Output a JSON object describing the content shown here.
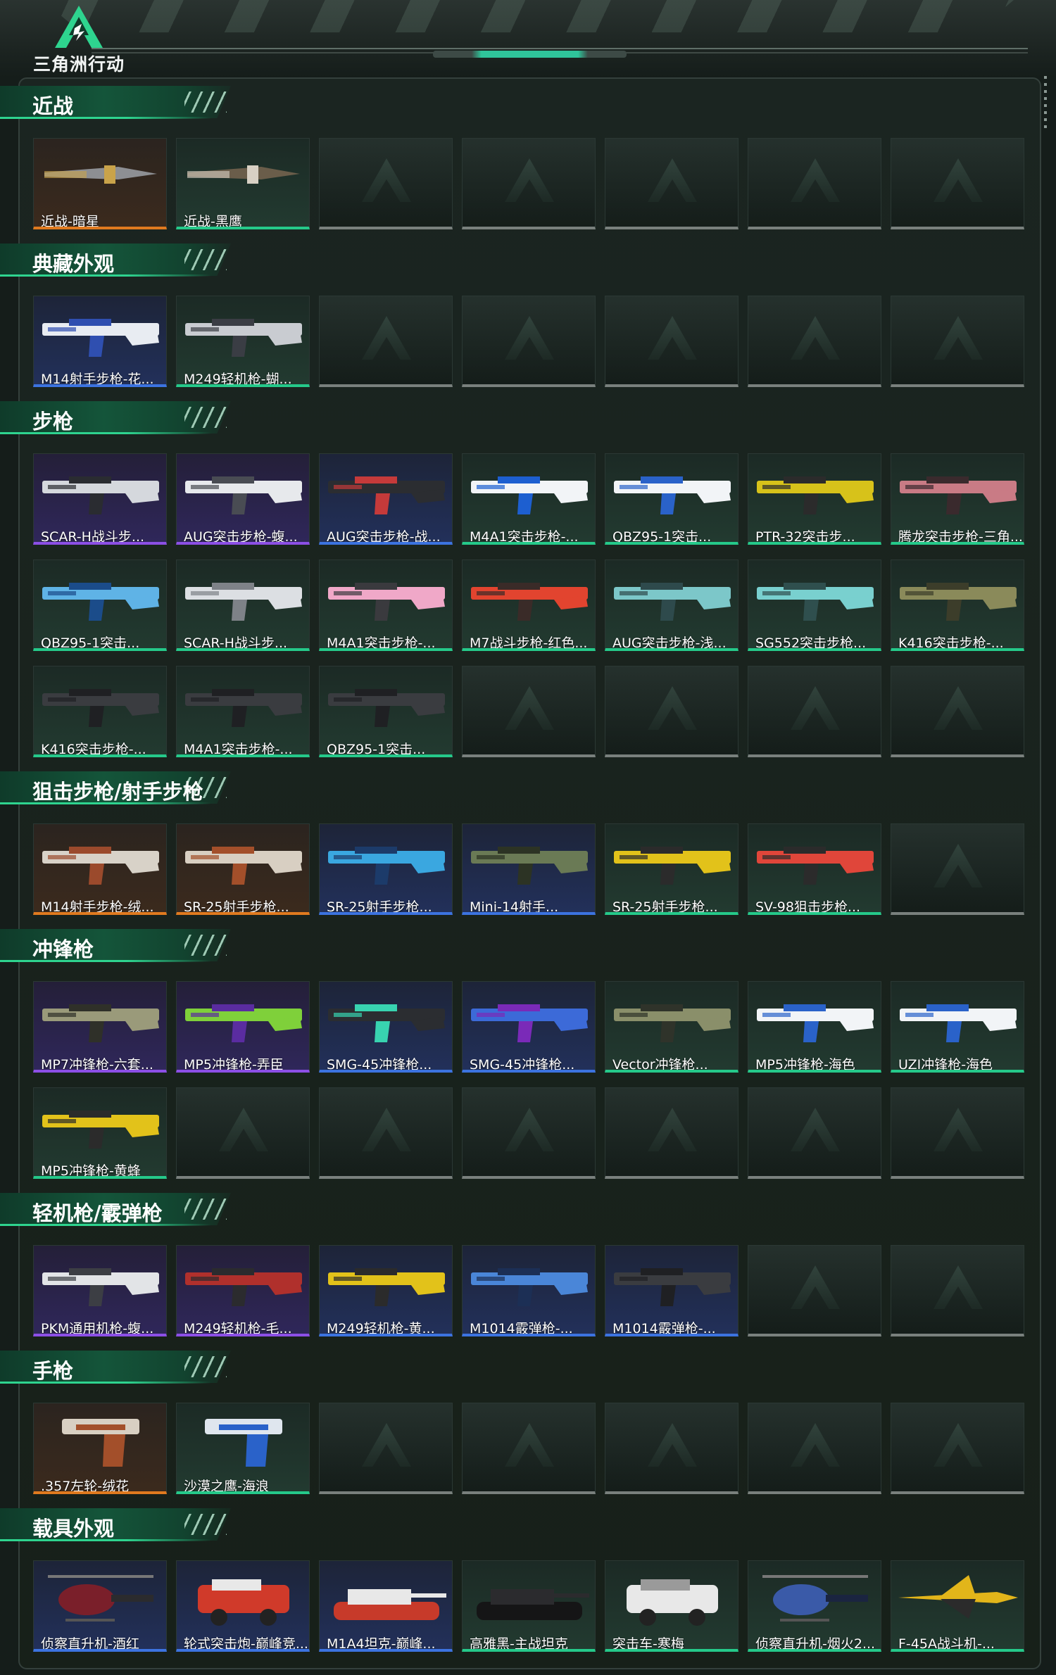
{
  "header": {
    "logo_text": "三角洲行动"
  },
  "sections": [
    {
      "title": "近战",
      "cards": [
        {
          "label": "近战-暗星",
          "quality": "orange",
          "icon": "knife-icon",
          "colors": [
            "#8d8f93",
            "#c9a34a"
          ]
        },
        {
          "label": "近战-黑鹰",
          "quality": "green",
          "icon": "knife-icon",
          "colors": [
            "#6a5d4a",
            "#d8d0c4"
          ]
        },
        null,
        null,
        null,
        null,
        null
      ]
    },
    {
      "title": "典藏外观",
      "cards": [
        {
          "label": "M14射手步枪-花...",
          "quality": "blue",
          "icon": "rifle-icon",
          "colors": [
            "#e8ecf2",
            "#2f4fb0"
          ]
        },
        {
          "label": "M249轻机枪-蝴...",
          "quality": "green",
          "icon": "lmg-icon",
          "colors": [
            "#c9ccd1",
            "#3a3d44"
          ]
        },
        null,
        null,
        null,
        null,
        null
      ]
    },
    {
      "title": "步枪",
      "cards": [
        {
          "label": "SCAR-H战斗步...",
          "quality": "purple",
          "icon": "rifle-icon",
          "colors": [
            "#d5d8dd",
            "#2a2c31"
          ]
        },
        {
          "label": "AUG突击步枪-蝮...",
          "quality": "purple",
          "icon": "rifle-icon",
          "colors": [
            "#e7e9ec",
            "#494c53"
          ]
        },
        {
          "label": "AUG突击步枪-战...",
          "quality": "blue",
          "icon": "rifle-icon",
          "colors": [
            "#2b2d31",
            "#c53a3a"
          ]
        },
        {
          "label": "M4A1突击步枪-...",
          "quality": "green",
          "icon": "rifle-icon",
          "colors": [
            "#f2f4f7",
            "#1d5fd0"
          ]
        },
        {
          "label": "QBZ95-1突击...",
          "quality": "green",
          "icon": "rifle-icon",
          "colors": [
            "#f2f4f7",
            "#2a62c9"
          ]
        },
        {
          "label": "PTR-32突击步...",
          "quality": "green",
          "icon": "rifle-icon",
          "colors": [
            "#d7c21a",
            "#2b2b2b"
          ]
        },
        {
          "label": "腾龙突击步枪-三角...",
          "quality": "green",
          "icon": "rifle-icon",
          "colors": [
            "#c97b85",
            "#3a2a2d"
          ]
        },
        {
          "label": "QBZ95-1突击...",
          "quality": "green",
          "icon": "rifle-icon",
          "colors": [
            "#5fb3e6",
            "#1b4c8a"
          ]
        },
        {
          "label": "SCAR-H战斗步...",
          "quality": "green",
          "icon": "rifle-icon",
          "colors": [
            "#dcdfe3",
            "#7e8288"
          ]
        },
        {
          "label": "M4A1突击步枪-...",
          "quality": "green",
          "icon": "rifle-icon",
          "colors": [
            "#f0a8c8",
            "#3a3a3e"
          ]
        },
        {
          "label": "M7战斗步枪-红色...",
          "quality": "green",
          "icon": "rifle-icon",
          "colors": [
            "#e2442f",
            "#3a2b28"
          ]
        },
        {
          "label": "AUG突击步枪-浅...",
          "quality": "green",
          "icon": "rifle-icon",
          "colors": [
            "#7cc7c9",
            "#2e4a4c"
          ]
        },
        {
          "label": "SG552突击步枪...",
          "quality": "green",
          "icon": "rifle-icon",
          "colors": [
            "#79d0cf",
            "#2f4f4e"
          ]
        },
        {
          "label": "K416突击步枪-...",
          "quality": "green",
          "icon": "rifle-icon",
          "colors": [
            "#8a8a5a",
            "#3c3d2a"
          ]
        },
        {
          "label": "K416突击步枪-...",
          "quality": "green",
          "icon": "rifle-icon",
          "colors": [
            "#3a3c40",
            "#1f2023"
          ]
        },
        {
          "label": "M4A1突击步枪-...",
          "quality": "green",
          "icon": "rifle-icon",
          "colors": [
            "#3a3c40",
            "#1f2023"
          ]
        },
        {
          "label": "QBZ95-1突击...",
          "quality": "green",
          "icon": "rifle-icon",
          "colors": [
            "#3a3c40",
            "#1f2023"
          ]
        },
        null,
        null,
        null,
        null
      ]
    },
    {
      "title": "狙击步枪/射手步枪",
      "cards": [
        {
          "label": "M14射手步枪-绒...",
          "quality": "orange",
          "icon": "sniper-icon",
          "colors": [
            "#d8d2c8",
            "#9b4a2c"
          ]
        },
        {
          "label": "SR-25射手步枪...",
          "quality": "orange",
          "icon": "sniper-icon",
          "colors": [
            "#d8cfc2",
            "#a34f2a"
          ]
        },
        {
          "label": "SR-25射手步枪...",
          "quality": "blue",
          "icon": "sniper-icon",
          "colors": [
            "#3aa7e0",
            "#1c3b6a"
          ]
        },
        {
          "label": "Mini-14射手...",
          "quality": "blue",
          "icon": "sniper-icon",
          "colors": [
            "#6a7a55",
            "#2c3324"
          ]
        },
        {
          "label": "SR-25射手步枪...",
          "quality": "green",
          "icon": "sniper-icon",
          "colors": [
            "#e2c21a",
            "#2b2b2b"
          ]
        },
        {
          "label": "SV-98狙击步枪...",
          "quality": "green",
          "icon": "sniper-icon",
          "colors": [
            "#e0463a",
            "#2b2b2b"
          ]
        },
        null
      ]
    },
    {
      "title": "冲锋枪",
      "cards": [
        {
          "label": "MP7冲锋枪-六套...",
          "quality": "purple",
          "icon": "smg-icon",
          "colors": [
            "#9a9a7a",
            "#2f3029"
          ]
        },
        {
          "label": "MP5冲锋枪-弄臣",
          "quality": "purple",
          "icon": "smg-icon",
          "colors": [
            "#7fd03a",
            "#5a2ca0"
          ]
        },
        {
          "label": "SMG-45冲锋枪...",
          "quality": "blue",
          "icon": "smg-icon",
          "colors": [
            "#2b2d31",
            "#38d3b0"
          ]
        },
        {
          "label": "SMG-45冲锋枪...",
          "quality": "blue",
          "icon": "smg-icon",
          "colors": [
            "#3c6ad8",
            "#7a2ab8"
          ]
        },
        {
          "label": "Vector冲锋枪...",
          "quality": "green",
          "icon": "smg-icon",
          "colors": [
            "#8a8f6a",
            "#2f332a"
          ]
        },
        {
          "label": "MP5冲锋枪-海色",
          "quality": "green",
          "icon": "smg-icon",
          "colors": [
            "#f2f4f7",
            "#2a62c9"
          ]
        },
        {
          "label": "UZI冲锋枪-海色",
          "quality": "green",
          "icon": "smg-icon",
          "colors": [
            "#f2f4f7",
            "#2a62c9"
          ]
        },
        {
          "label": "MP5冲锋枪-黄蜂",
          "quality": "green",
          "icon": "smg-icon",
          "colors": [
            "#e2c21a",
            "#2b2b2b"
          ]
        },
        null,
        null,
        null,
        null,
        null,
        null
      ]
    },
    {
      "title": "轻机枪/霰弹枪",
      "cards": [
        {
          "label": "PKM通用机枪-蝮...",
          "quality": "purple",
          "icon": "lmg-icon",
          "colors": [
            "#e2e4e7",
            "#3c3e44"
          ]
        },
        {
          "label": "M249轻机枪-毛...",
          "quality": "purple",
          "icon": "lmg-icon",
          "colors": [
            "#b0302c",
            "#2b2b2e"
          ]
        },
        {
          "label": "M249轻机枪-黄...",
          "quality": "blue",
          "icon": "lmg-icon",
          "colors": [
            "#e2c21a",
            "#2b2b2b"
          ]
        },
        {
          "label": "M1014霰弹枪-...",
          "quality": "blue",
          "icon": "shotgun-icon",
          "colors": [
            "#4a86d8",
            "#1c2f55"
          ]
        },
        {
          "label": "M1014霰弹枪-...",
          "quality": "blue",
          "icon": "shotgun-icon",
          "colors": [
            "#3a3c40",
            "#1f2023"
          ]
        },
        null,
        null
      ]
    },
    {
      "title": "手枪",
      "cards": [
        {
          "label": ".357左轮-绒花",
          "quality": "orange",
          "icon": "pistol-icon",
          "colors": [
            "#d8cfc2",
            "#a34f2a"
          ]
        },
        {
          "label": "沙漠之鹰-海浪",
          "quality": "green",
          "icon": "pistol-icon",
          "colors": [
            "#dfe6ee",
            "#2a62c9"
          ]
        },
        null,
        null,
        null,
        null,
        null
      ]
    },
    {
      "title": "载具外观",
      "cards": [
        {
          "label": "侦察直升机-酒红",
          "quality": "blue",
          "icon": "helicopter-icon",
          "colors": [
            "#7a1f2a",
            "#2b2b2e"
          ]
        },
        {
          "label": "轮式突击炮-巅峰竞...",
          "quality": "blue",
          "icon": "vehicle-icon",
          "colors": [
            "#d03a2a",
            "#e8e8e8"
          ]
        },
        {
          "label": "M1A4坦克-巅峰...",
          "quality": "blue",
          "icon": "tank-icon",
          "colors": [
            "#e8e8e8",
            "#c73a2a"
          ]
        },
        {
          "label": "高雅黑-主战坦克",
          "quality": "green",
          "icon": "tank-icon",
          "colors": [
            "#2b2b2e",
            "#151516"
          ]
        },
        {
          "label": "突击车-寒梅",
          "quality": "green",
          "icon": "vehicle-icon",
          "colors": [
            "#e8e8e8",
            "#9a9a9a"
          ]
        },
        {
          "label": "侦察直升机-烟火2...",
          "quality": "green",
          "icon": "helicopter-icon",
          "colors": [
            "#3a5aa8",
            "#1a2440"
          ]
        },
        {
          "label": "F-45A战斗机-...",
          "quality": "green",
          "icon": "jet-icon",
          "colors": [
            "#e2b51a",
            "#2b2b2b"
          ]
        }
      ]
    }
  ]
}
